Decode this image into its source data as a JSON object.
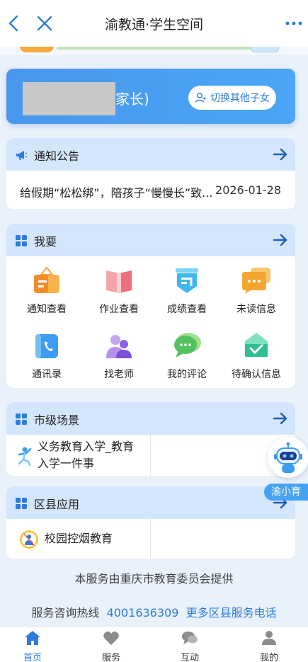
{
  "nav": {
    "title": "渝教通·学生空间"
  },
  "parent_card": {
    "name_suffix": "家长)",
    "switch_label": "切换其他子女"
  },
  "notice": {
    "title": "通知公告",
    "item_text": "给假期“松松绑”，陪孩子“慢慢长”致...",
    "item_date": "2026-01-28"
  },
  "iwant": {
    "title": "我要",
    "items": [
      {
        "label": "通知查看",
        "icon": "notice-view-icon",
        "color": "#f3a23a"
      },
      {
        "label": "作业查看",
        "icon": "homework-icon",
        "color": "#f07b83"
      },
      {
        "label": "成绩查看",
        "icon": "grades-icon",
        "color": "#3fb6ee"
      },
      {
        "label": "未读信息",
        "icon": "unread-message-icon",
        "color": "#f6b338"
      },
      {
        "label": "通讯录",
        "icon": "contacts-icon",
        "color": "#3d9df2"
      },
      {
        "label": "找老师",
        "icon": "find-teacher-icon",
        "color": "#9d6fe6"
      },
      {
        "label": "我的评论",
        "icon": "my-comments-icon",
        "color": "#5cc96a"
      },
      {
        "label": "待确认信息",
        "icon": "pending-info-icon",
        "color": "#34c79b"
      }
    ]
  },
  "city": {
    "title": "市级场景",
    "service_line1": "义务教育入学_教育",
    "service_line2": "入学一件事"
  },
  "district": {
    "title": "区县应用",
    "service": "校园控烟教育"
  },
  "bot": {
    "label": "渝小育"
  },
  "footer": {
    "provider": "本服务由重庆市教育委员会提供",
    "hotline_label": "服务咨询热线",
    "hotline": "4001636309",
    "more_link": "更多区县服务电话"
  },
  "tabs": [
    {
      "label": "首页",
      "icon": "home-icon"
    },
    {
      "label": "服务",
      "icon": "heart-icon"
    },
    {
      "label": "互动",
      "icon": "chat-icon"
    },
    {
      "label": "我的",
      "icon": "user-icon"
    }
  ],
  "colors": {
    "accent": "#2d7cdb",
    "section_head": "#d4e6fb",
    "banner": "#4a96ee"
  }
}
